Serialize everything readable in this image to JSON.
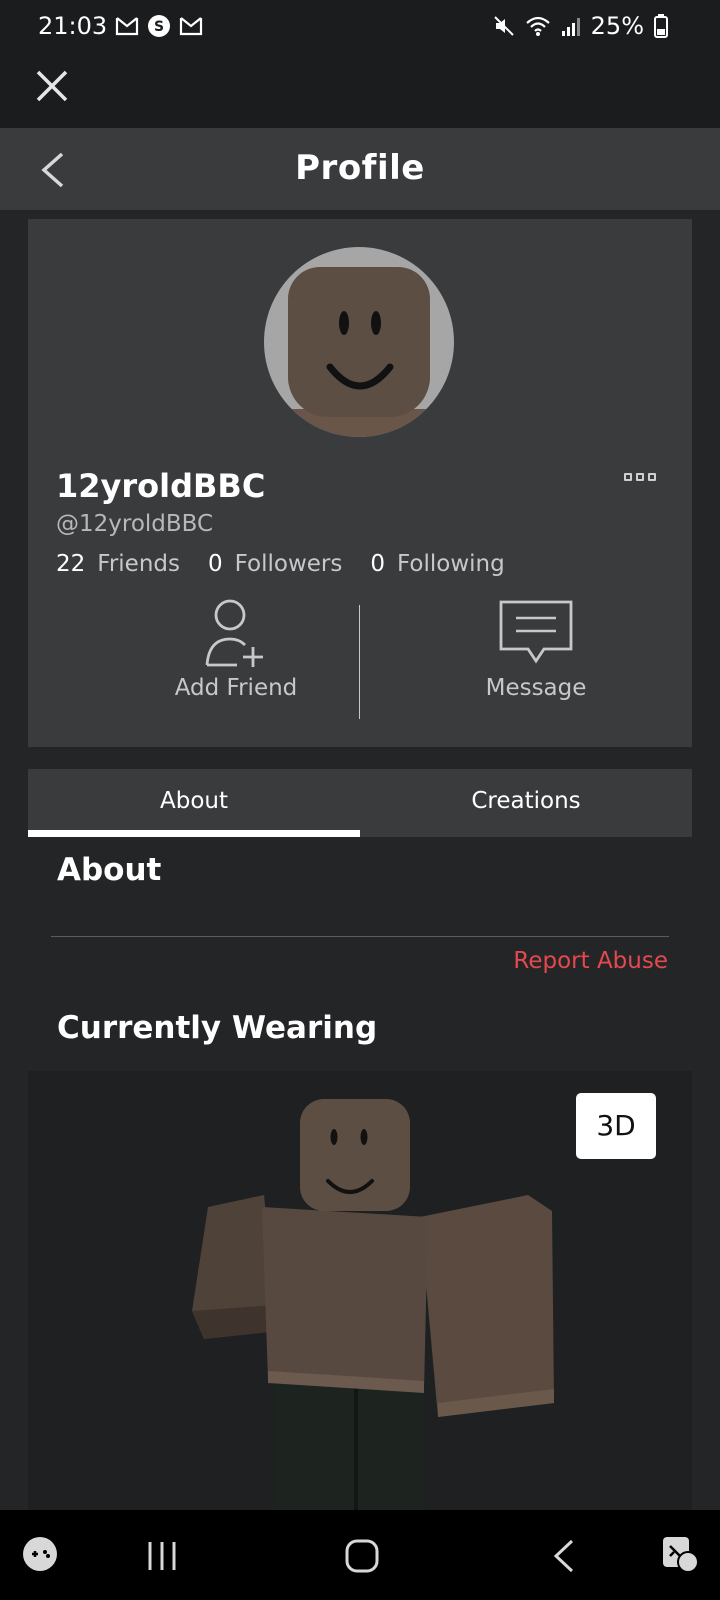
{
  "status_bar": {
    "time": "21:03",
    "battery": "25%"
  },
  "header": {
    "title": "Profile"
  },
  "profile": {
    "display_name": "12yroldBBC",
    "username": "@12yroldBBC",
    "stats": [
      {
        "count": "22",
        "label": "Friends"
      },
      {
        "count": "0",
        "label": "Followers"
      },
      {
        "count": "0",
        "label": "Following"
      }
    ],
    "actions": {
      "add_friend": "Add Friend",
      "message": "Message"
    }
  },
  "tabs": {
    "about": "About",
    "creations": "Creations"
  },
  "about_section": {
    "heading": "About",
    "report_abuse": "Report Abuse"
  },
  "wearing_section": {
    "heading": "Currently Wearing",
    "view_3d": "3D"
  },
  "colors": {
    "background": "#232527",
    "card": "#393b3d",
    "report_red": "#e5484d",
    "avatar_skin": "#5d4e43"
  }
}
